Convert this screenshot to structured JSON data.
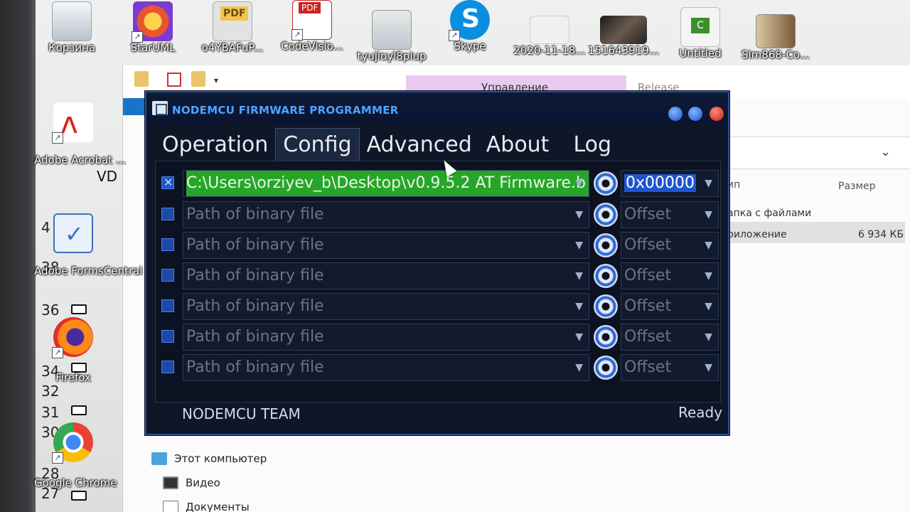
{
  "desktop": {
    "icons": [
      {
        "label": "Корзина"
      },
      {
        "label": "StarUML"
      },
      {
        "label": "o4YBAFuP..."
      },
      {
        "label": "CodeVisio..."
      },
      {
        "label": "tyujioyl8piup"
      },
      {
        "label": "Skype"
      },
      {
        "label": "2020-11-18..."
      },
      {
        "label": "151643919..."
      },
      {
        "label": "Untitled"
      },
      {
        "label": "Sim868-Co..."
      },
      {
        "label": "Adobe Acrobat ..."
      },
      {
        "label": "Adobe FormsCentral"
      },
      {
        "label": "Firefox"
      },
      {
        "label": "Google Chrome"
      }
    ],
    "partial_text": "VD",
    "pdf_badge": "PDF",
    "ruler_numbers": [
      "4",
      "38",
      "36",
      "34",
      "32",
      "31",
      "30",
      "28",
      "27"
    ]
  },
  "explorer": {
    "ribbon_tab": "Управление",
    "ribbon_tab2": "Release",
    "column_type": "ип",
    "column_size": "Размер",
    "rows": [
      {
        "type": "апка с файлами",
        "size": ""
      },
      {
        "type": "риложение",
        "size": "6 934 КБ"
      }
    ],
    "nav": [
      {
        "label": "Этот компьютер"
      },
      {
        "label": "Видео"
      },
      {
        "label": "Документы"
      }
    ]
  },
  "app": {
    "title": "NODEMCU FIRMWARE PROGRAMMER",
    "tabs": [
      "Operation",
      "Config",
      "Advanced",
      "About",
      "Log"
    ],
    "active_tab": "Config",
    "rows": [
      {
        "checked": true,
        "path": "C:\\Users\\orziyev_b\\Desktop\\v0.9.5.2 AT Firmware.b",
        "offset": "0x00000"
      },
      {
        "checked": false,
        "path_placeholder": "Path of binary file",
        "offset_placeholder": "Offset"
      },
      {
        "checked": false,
        "path_placeholder": "Path of binary file",
        "offset_placeholder": "Offset"
      },
      {
        "checked": false,
        "path_placeholder": "Path of binary file",
        "offset_placeholder": "Offset"
      },
      {
        "checked": false,
        "path_placeholder": "Path of binary file",
        "offset_placeholder": "Offset"
      },
      {
        "checked": false,
        "path_placeholder": "Path of binary file",
        "offset_placeholder": "Offset"
      },
      {
        "checked": false,
        "path_placeholder": "Path of binary file",
        "offset_placeholder": "Offset"
      }
    ],
    "footer_left": "NODEMCU TEAM",
    "footer_right": "Ready"
  }
}
